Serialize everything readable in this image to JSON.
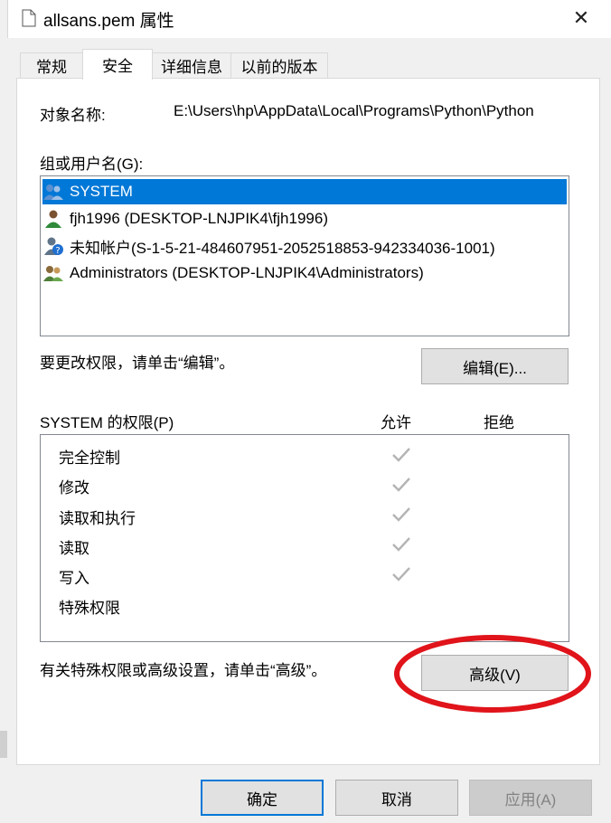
{
  "window": {
    "title": "allsans.pem 属性",
    "close_glyph": "✕"
  },
  "tabs": [
    "常规",
    "安全",
    "详细信息",
    "以前的版本"
  ],
  "object": {
    "label": "对象名称:",
    "value": "E:\\Users\\hp\\AppData\\Local\\Programs\\Python\\Python"
  },
  "groups": {
    "label": "组或用户名(G):",
    "items": [
      "SYSTEM",
      "fjh1996 (DESKTOP-LNJPIK4\\fjh1996)",
      "未知帐户(S-1-5-21-484607951-2052518853-942334036-1001)",
      "Administrators (DESKTOP-LNJPIK4\\Administrators)"
    ]
  },
  "edit": {
    "hint": "要更改权限，请单击“编辑”。",
    "button": "编辑(E)..."
  },
  "permissions": {
    "title": "SYSTEM 的权限(P)",
    "allow_header": "允许",
    "deny_header": "拒绝",
    "rows": [
      "完全控制",
      "修改",
      "读取和执行",
      "读取",
      "写入",
      "特殊权限"
    ]
  },
  "advanced": {
    "hint": "有关特殊权限或高级设置，请单击“高级”。",
    "button": "高级(V)"
  },
  "footer": {
    "ok": "确定",
    "cancel": "取消",
    "apply": "应用(A)"
  },
  "colors": {
    "selection": "#0078d7",
    "annotation": "#e0141a",
    "check": "#b4b4b4"
  }
}
